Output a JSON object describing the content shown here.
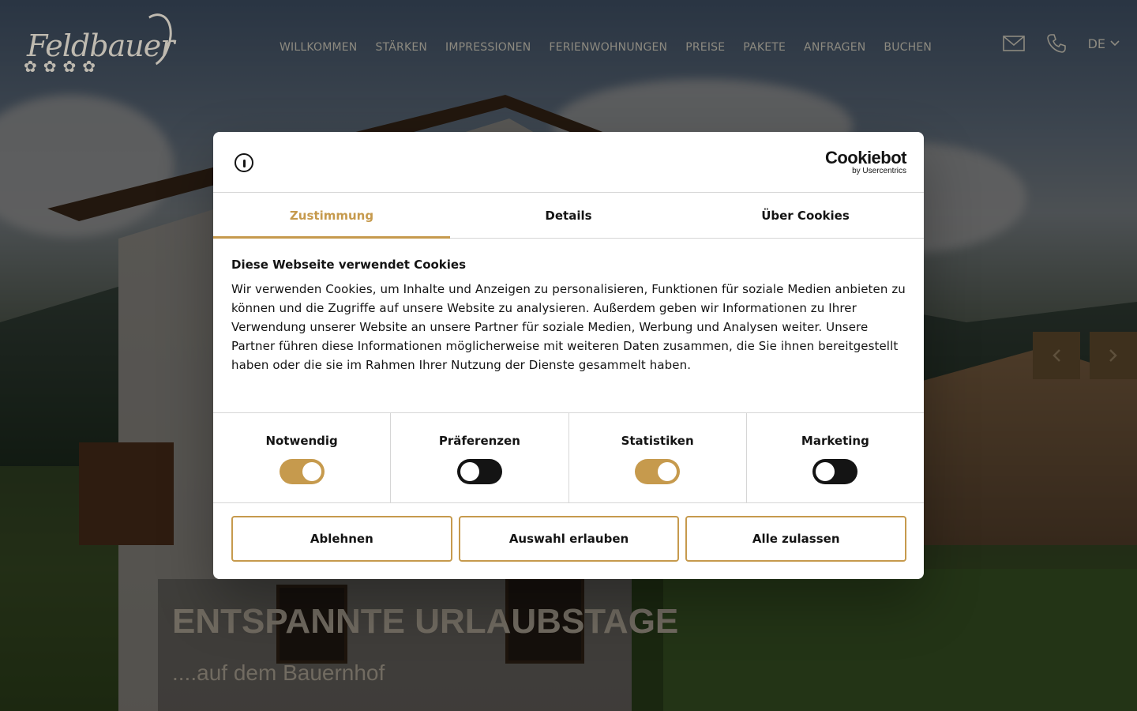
{
  "site": {
    "logo_text": "Feldbauer",
    "logo_flowers": [
      "✿",
      "✿",
      "✿",
      "✿"
    ]
  },
  "nav": {
    "items": [
      "WILLKOMMEN",
      "STÄRKEN",
      "IMPRESSIONEN",
      "FERIENWOHNUNGEN",
      "PREISE",
      "PAKETE",
      "ANFRAGEN",
      "BUCHEN"
    ]
  },
  "header_icons": {
    "mail": "mail-icon",
    "phone": "phone-icon",
    "language": "DE"
  },
  "hero": {
    "title": "ENTSPANNTE URLAUBSTAGE",
    "subtitle": "....auf dem Bauernhof"
  },
  "cookie_dialog": {
    "brand_name": "Cookiebot",
    "brand_by": "by Usercentrics",
    "tabs": [
      {
        "label": "Zustimmung",
        "active": true
      },
      {
        "label": "Details",
        "active": false
      },
      {
        "label": "Über Cookies",
        "active": false
      }
    ],
    "title": "Diese Webseite verwendet Cookies",
    "text": "Wir verwenden Cookies, um Inhalte und Anzeigen zu personalisieren, Funktionen für soziale Medien anbieten zu können und die Zugriffe auf unsere Website zu analysieren. Außerdem geben wir Informationen zu Ihrer Verwendung unserer Website an unsere Partner für soziale Medien, Werbung und Analysen weiter. Unsere Partner führen diese Informationen möglicherweise mit weiteren Daten zusammen, die Sie ihnen bereitgestellt haben oder die sie im Rahmen Ihrer Nutzung der Dienste gesammelt haben.",
    "categories": [
      {
        "label": "Notwendig",
        "enabled": true
      },
      {
        "label": "Präferenzen",
        "enabled": false
      },
      {
        "label": "Statistiken",
        "enabled": true
      },
      {
        "label": "Marketing",
        "enabled": false
      }
    ],
    "buttons": {
      "decline": "Ablehnen",
      "allow_selection": "Auswahl erlauben",
      "allow_all": "Alle zulassen"
    }
  },
  "colors": {
    "accent": "#c69a4d",
    "dark": "#141414",
    "overlay_nav": "#8d8a80"
  }
}
